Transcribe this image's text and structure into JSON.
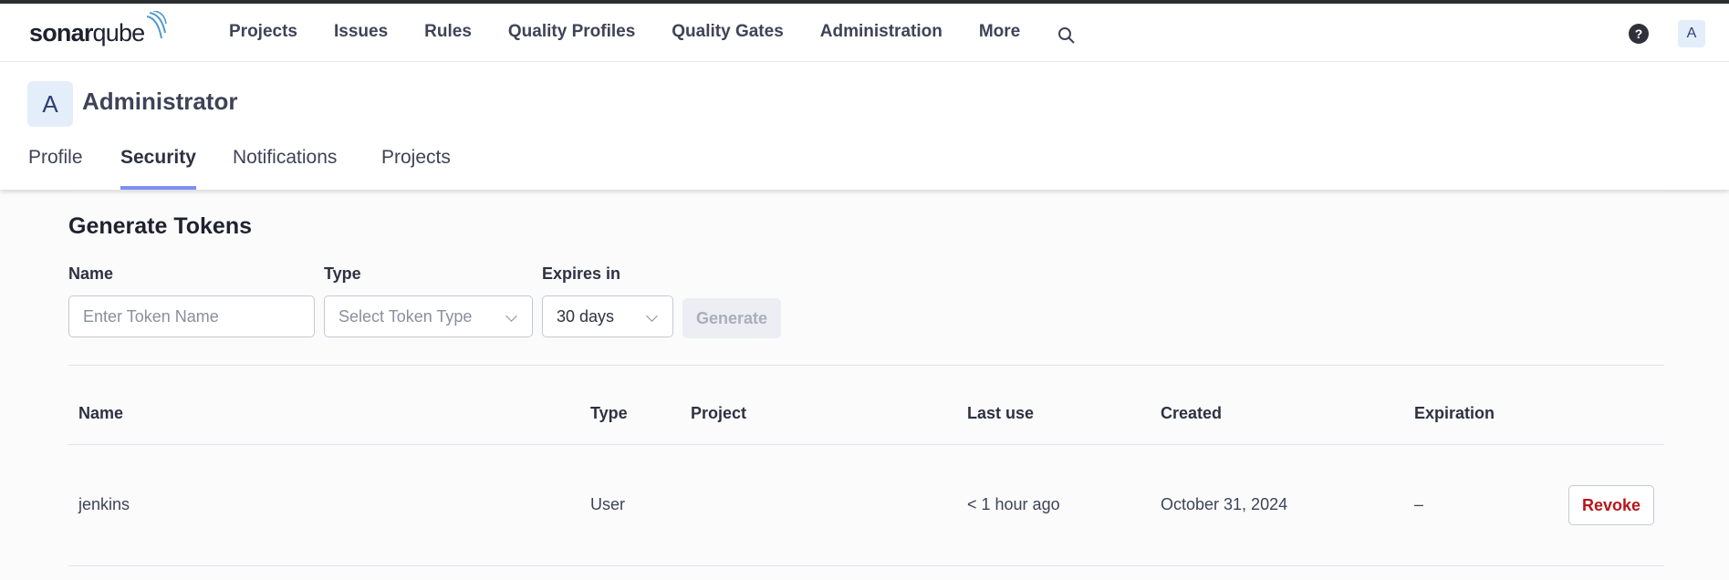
{
  "logo": {
    "brand": "sonar",
    "brand_suffix": "qube"
  },
  "nav": {
    "items": [
      "Projects",
      "Issues",
      "Rules",
      "Quality Profiles",
      "Quality Gates",
      "Administration",
      "More"
    ],
    "help_label": "?",
    "avatar_letter": "A"
  },
  "user": {
    "avatar_letter": "A",
    "name": "Administrator"
  },
  "tabs": [
    {
      "label": "Profile",
      "active": false
    },
    {
      "label": "Security",
      "active": true
    },
    {
      "label": "Notifications",
      "active": false
    },
    {
      "label": "Projects",
      "active": false
    }
  ],
  "generate": {
    "title": "Generate Tokens",
    "name_label": "Name",
    "name_placeholder": "Enter Token Name",
    "type_label": "Type",
    "type_placeholder": "Select Token Type",
    "expires_label": "Expires in",
    "expires_value": "30 days",
    "button_label": "Generate"
  },
  "table": {
    "headers": [
      "Name",
      "Type",
      "Project",
      "Last use",
      "Created",
      "Expiration"
    ],
    "rows": [
      {
        "name": "jenkins",
        "type": "User",
        "project": "",
        "last_use": "< 1 hour ago",
        "created": "October 31, 2024",
        "expiration": "–",
        "action": "Revoke"
      }
    ]
  },
  "colors": {
    "accent": "#7d8ff0",
    "danger": "#b8151b",
    "nav_text": "#3e4357"
  }
}
